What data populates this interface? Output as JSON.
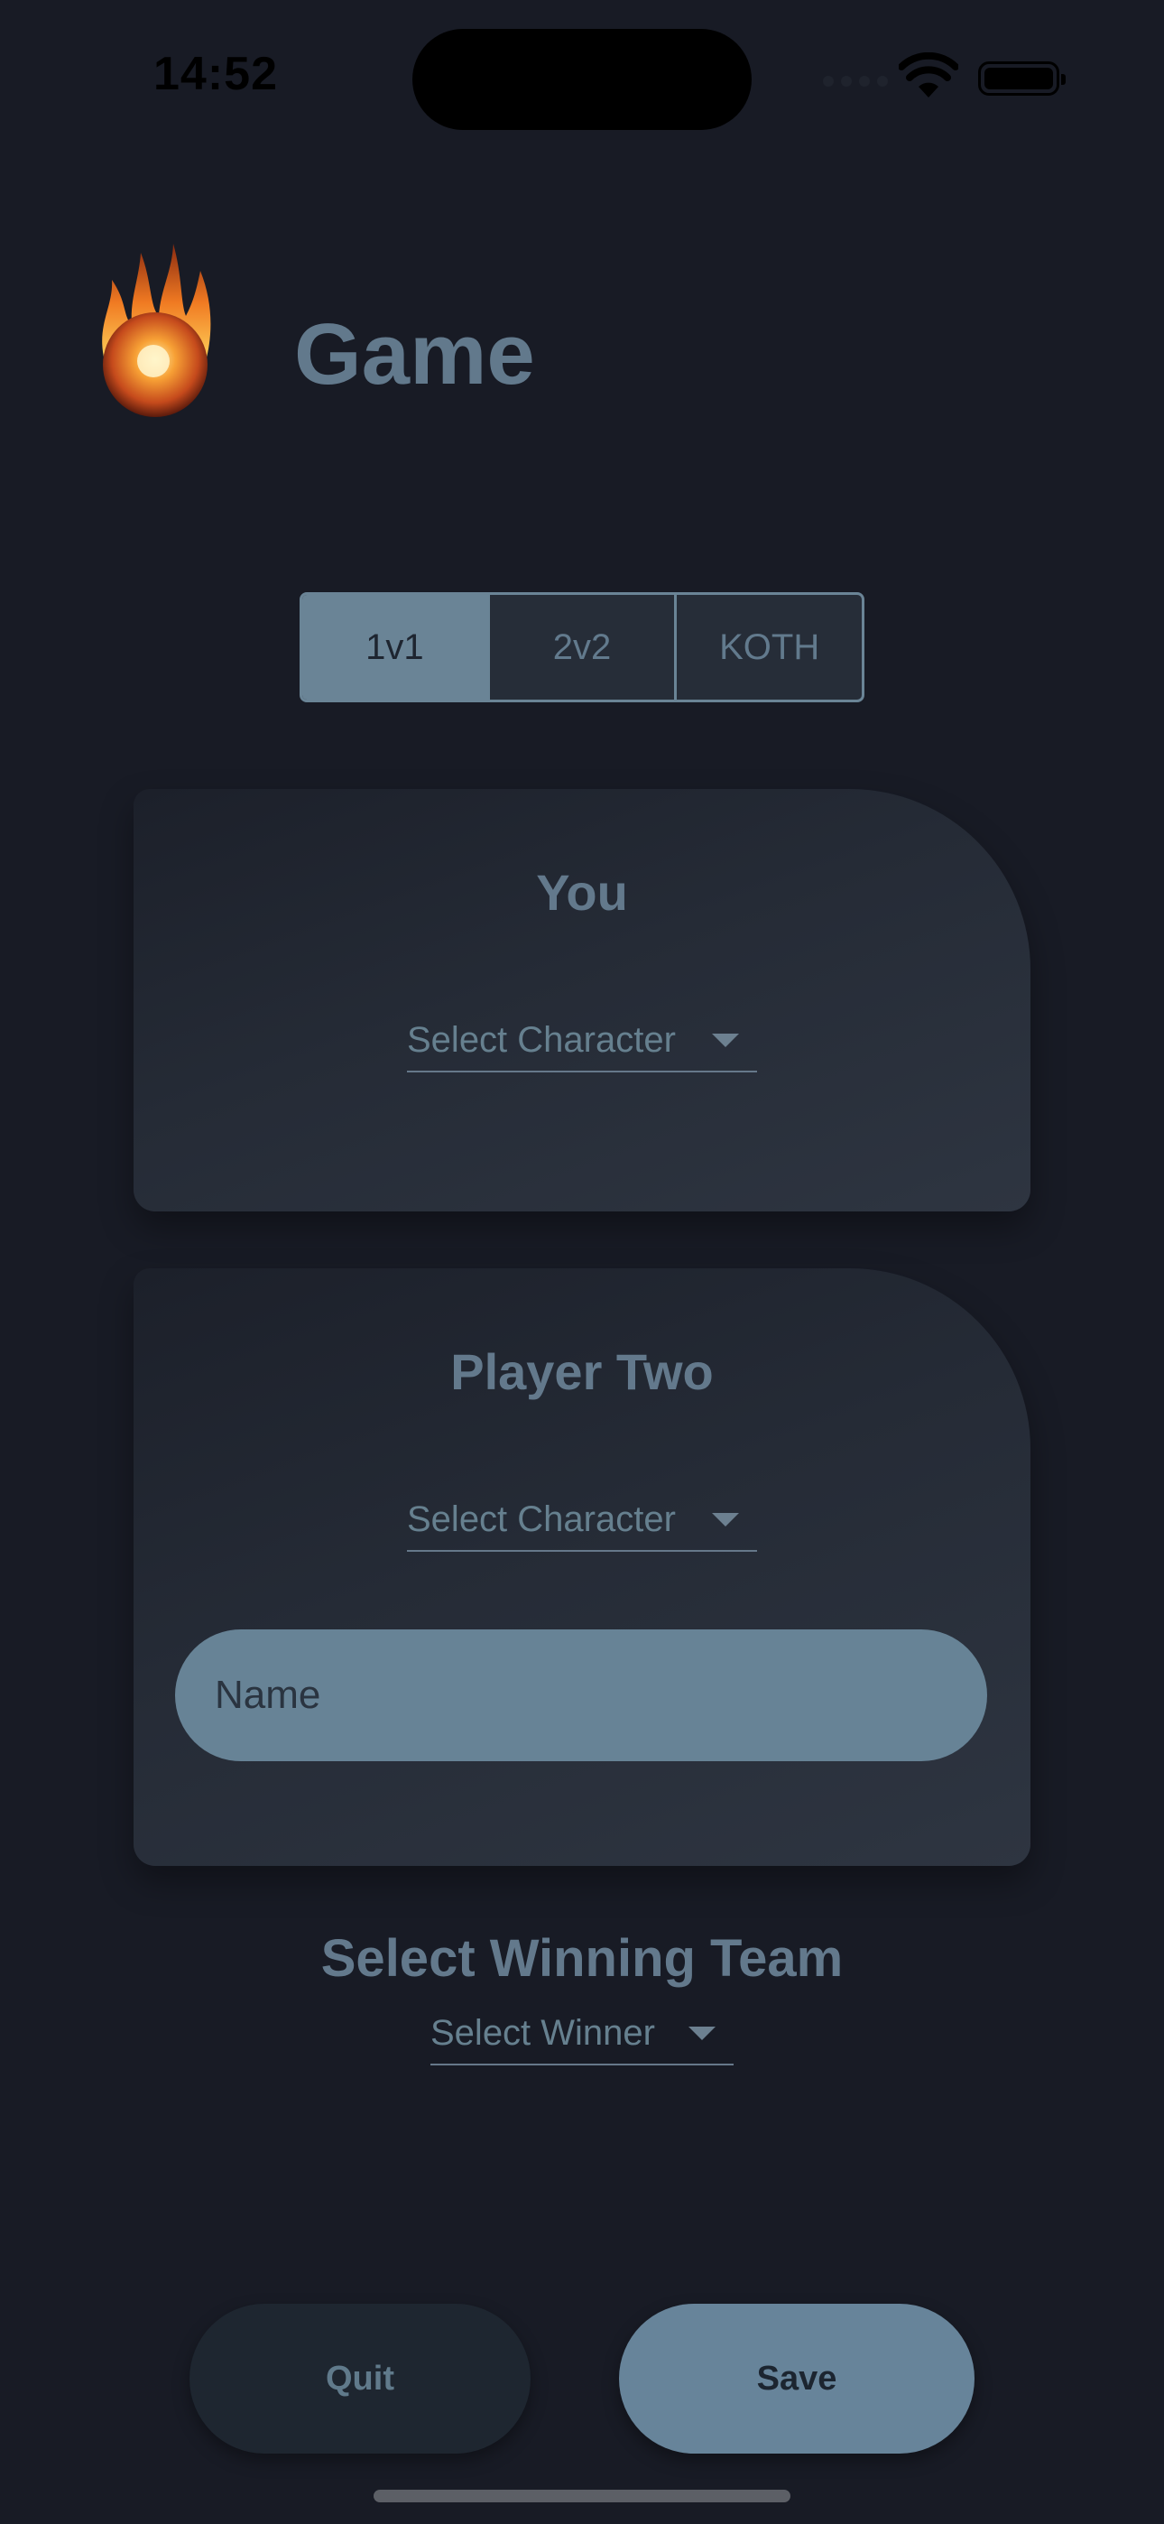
{
  "status_bar": {
    "time": "14:52"
  },
  "header": {
    "title": "Game",
    "logo_icon": "flaming-ball-logo"
  },
  "mode_tabs": [
    {
      "label": "1v1",
      "selected": true
    },
    {
      "label": "2v2",
      "selected": false
    },
    {
      "label": "KOTH",
      "selected": false
    }
  ],
  "card_you": {
    "title": "You",
    "character_select": "Select Character"
  },
  "card_player_two": {
    "title": "Player Two",
    "character_select": "Select Character",
    "name_placeholder": "Name"
  },
  "winning": {
    "title": "Select Winning Team",
    "select": "Select Winner"
  },
  "buttons": {
    "quit": "Quit",
    "save": "Save"
  },
  "colors": {
    "background": "#181b25",
    "accent": "#67849a",
    "text_muted": "#63798c"
  }
}
